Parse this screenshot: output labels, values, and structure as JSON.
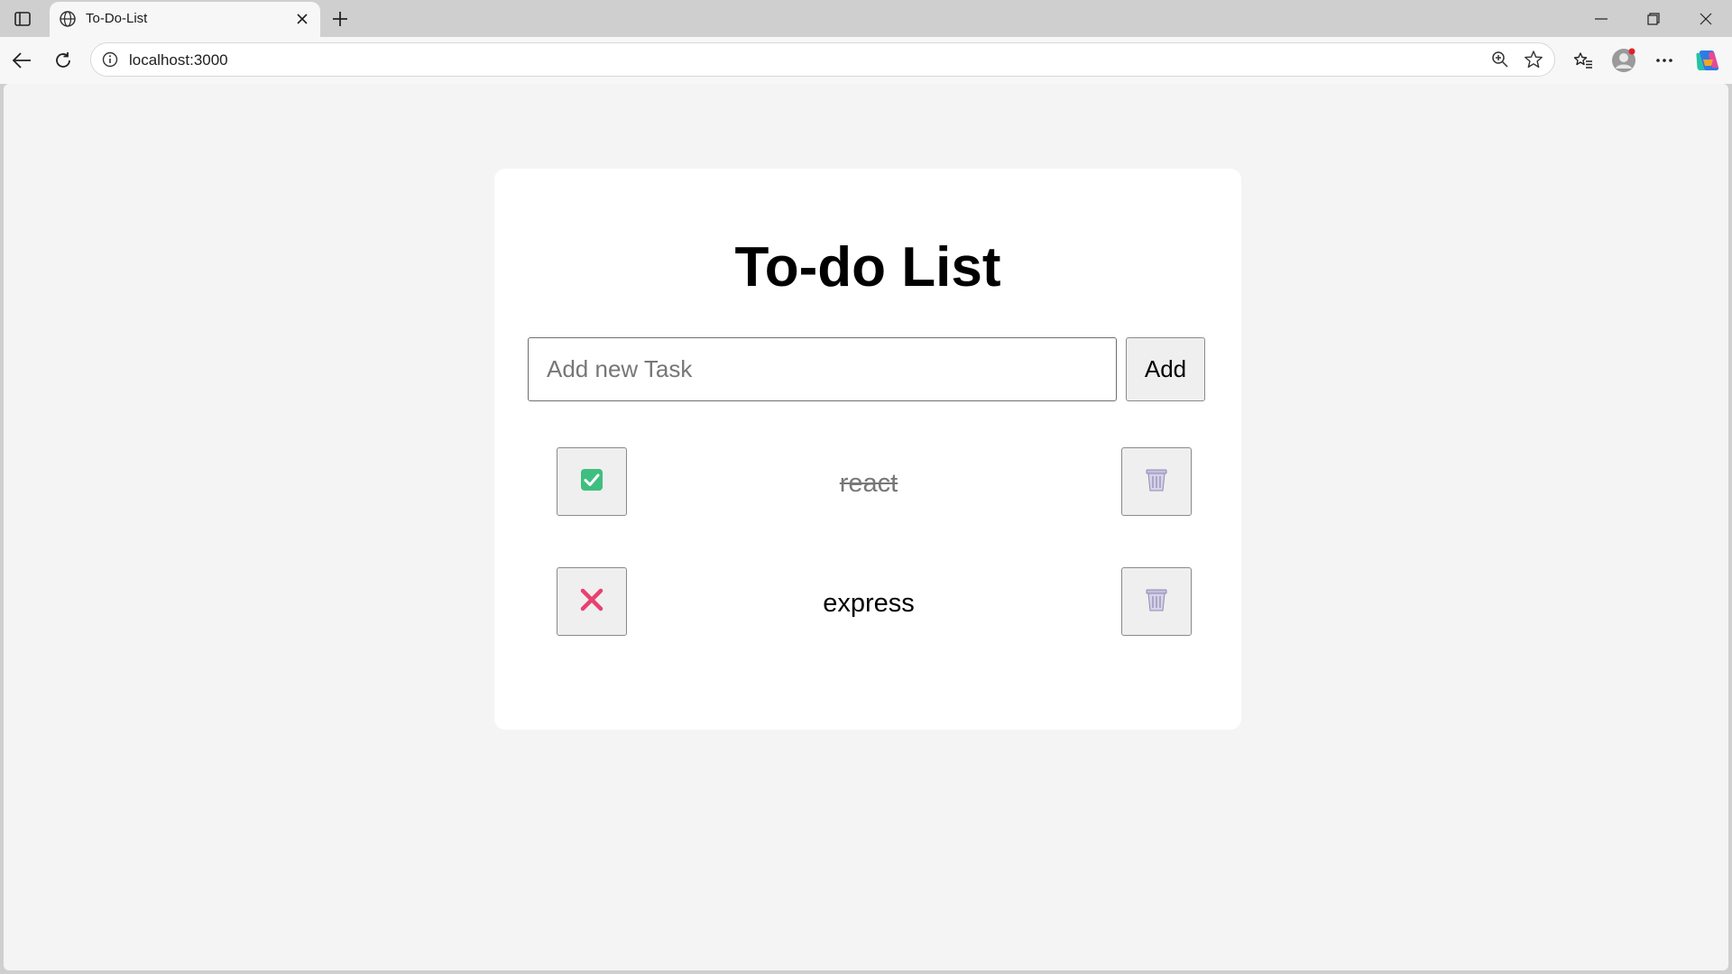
{
  "browser": {
    "tab_title": "To-Do-List",
    "url": "localhost:3000"
  },
  "page": {
    "title": "To-do List",
    "input": {
      "placeholder": "Add new Task",
      "value": ""
    },
    "add_label": "Add",
    "todos": [
      {
        "text": "react",
        "completed": true
      },
      {
        "text": "express",
        "completed": false
      }
    ]
  },
  "colors": {
    "check_green": "#3fbf7f",
    "cross_red": "#e8416f",
    "trash": "#b9b3d4"
  }
}
